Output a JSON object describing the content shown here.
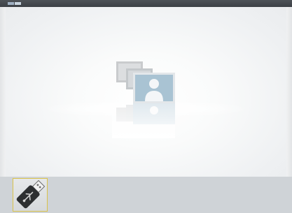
{
  "window": {
    "top_bar_icon": "small-window-icon"
  },
  "main": {
    "empty_state_icon": "photo-gallery-icon",
    "colors": {
      "background": "#f3f4f6",
      "photo_front": "#a9c3d3",
      "photo_back": "#c9cbcd"
    }
  },
  "devices": {
    "items": [
      {
        "icon": "usb-drive-icon",
        "selected": true
      }
    ],
    "colors": {
      "bar_background": "#cfd3d7",
      "selection_border": "#d9c24a"
    }
  }
}
